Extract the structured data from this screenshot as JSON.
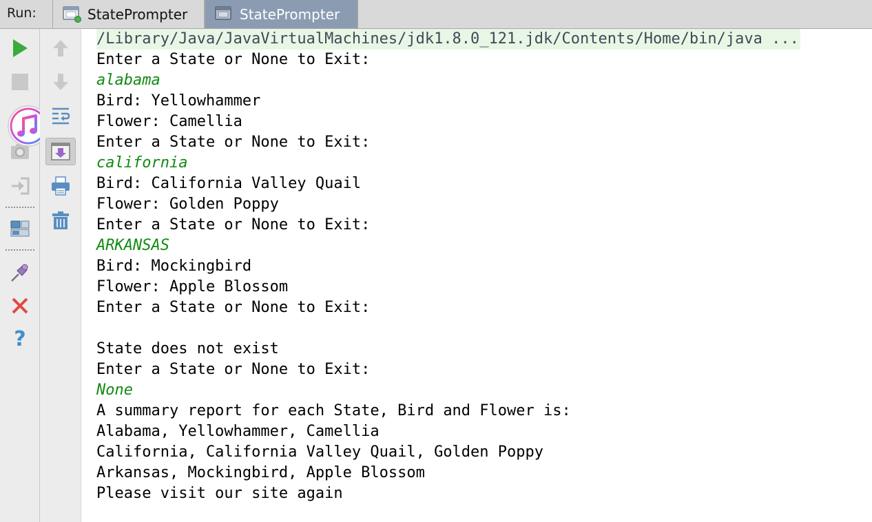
{
  "header": {
    "run_label": "Run:",
    "tabs": [
      {
        "label": "StatePrompter",
        "active": false
      },
      {
        "label": "StatePrompter",
        "active": true
      }
    ]
  },
  "colors": {
    "input_text": "#128a12",
    "command_bg": "#e9f6e6",
    "active_tab": "#8b9cb2",
    "run_green": "#3bab3b",
    "close_red": "#e0493d",
    "help_blue": "#3f8fcf"
  },
  "toolbar_left": {
    "icons": [
      "rerun-icon",
      "stop-icon",
      "dump-threads-icon",
      "login-icon",
      "restore-layout-icon",
      "pin-icon",
      "close-icon",
      "help-icon"
    ],
    "help_glyph": "?"
  },
  "toolbar_right": {
    "icons": [
      "up-arrow-icon",
      "down-arrow-icon",
      "soft-wrap-icon",
      "scroll-to-end-icon",
      "print-icon",
      "trash-icon"
    ]
  },
  "console": {
    "lines": [
      {
        "type": "cmd",
        "text": "/Library/Java/JavaVirtualMachines/jdk1.8.0_121.jdk/Contents/Home/bin/java ..."
      },
      {
        "type": "out",
        "text": "Enter a State or None to Exit:"
      },
      {
        "type": "input",
        "text": "alabama"
      },
      {
        "type": "out",
        "text": "Bird: Yellowhammer"
      },
      {
        "type": "out",
        "text": "Flower: Camellia"
      },
      {
        "type": "out",
        "text": "Enter a State or None to Exit:"
      },
      {
        "type": "input",
        "text": "california"
      },
      {
        "type": "out",
        "text": "Bird: California Valley Quail"
      },
      {
        "type": "out",
        "text": "Flower: Golden Poppy"
      },
      {
        "type": "out",
        "text": "Enter a State or None to Exit:"
      },
      {
        "type": "input",
        "text": "ARKANSAS"
      },
      {
        "type": "out",
        "text": "Bird: Mockingbird"
      },
      {
        "type": "out",
        "text": "Flower: Apple Blossom"
      },
      {
        "type": "out",
        "text": "Enter a State or None to Exit:"
      },
      {
        "type": "out",
        "text": ""
      },
      {
        "type": "out",
        "text": "State does not exist"
      },
      {
        "type": "out",
        "text": "Enter a State or None to Exit:"
      },
      {
        "type": "input",
        "text": "None"
      },
      {
        "type": "out",
        "text": "A summary report for each State, Bird and Flower is:"
      },
      {
        "type": "out",
        "text": "Alabama, Yellowhammer, Camellia"
      },
      {
        "type": "out",
        "text": "California, California Valley Quail, Golden Poppy"
      },
      {
        "type": "out",
        "text": "Arkansas, Mockingbird, Apple Blossom"
      },
      {
        "type": "out",
        "text": "Please visit our site again"
      }
    ]
  }
}
